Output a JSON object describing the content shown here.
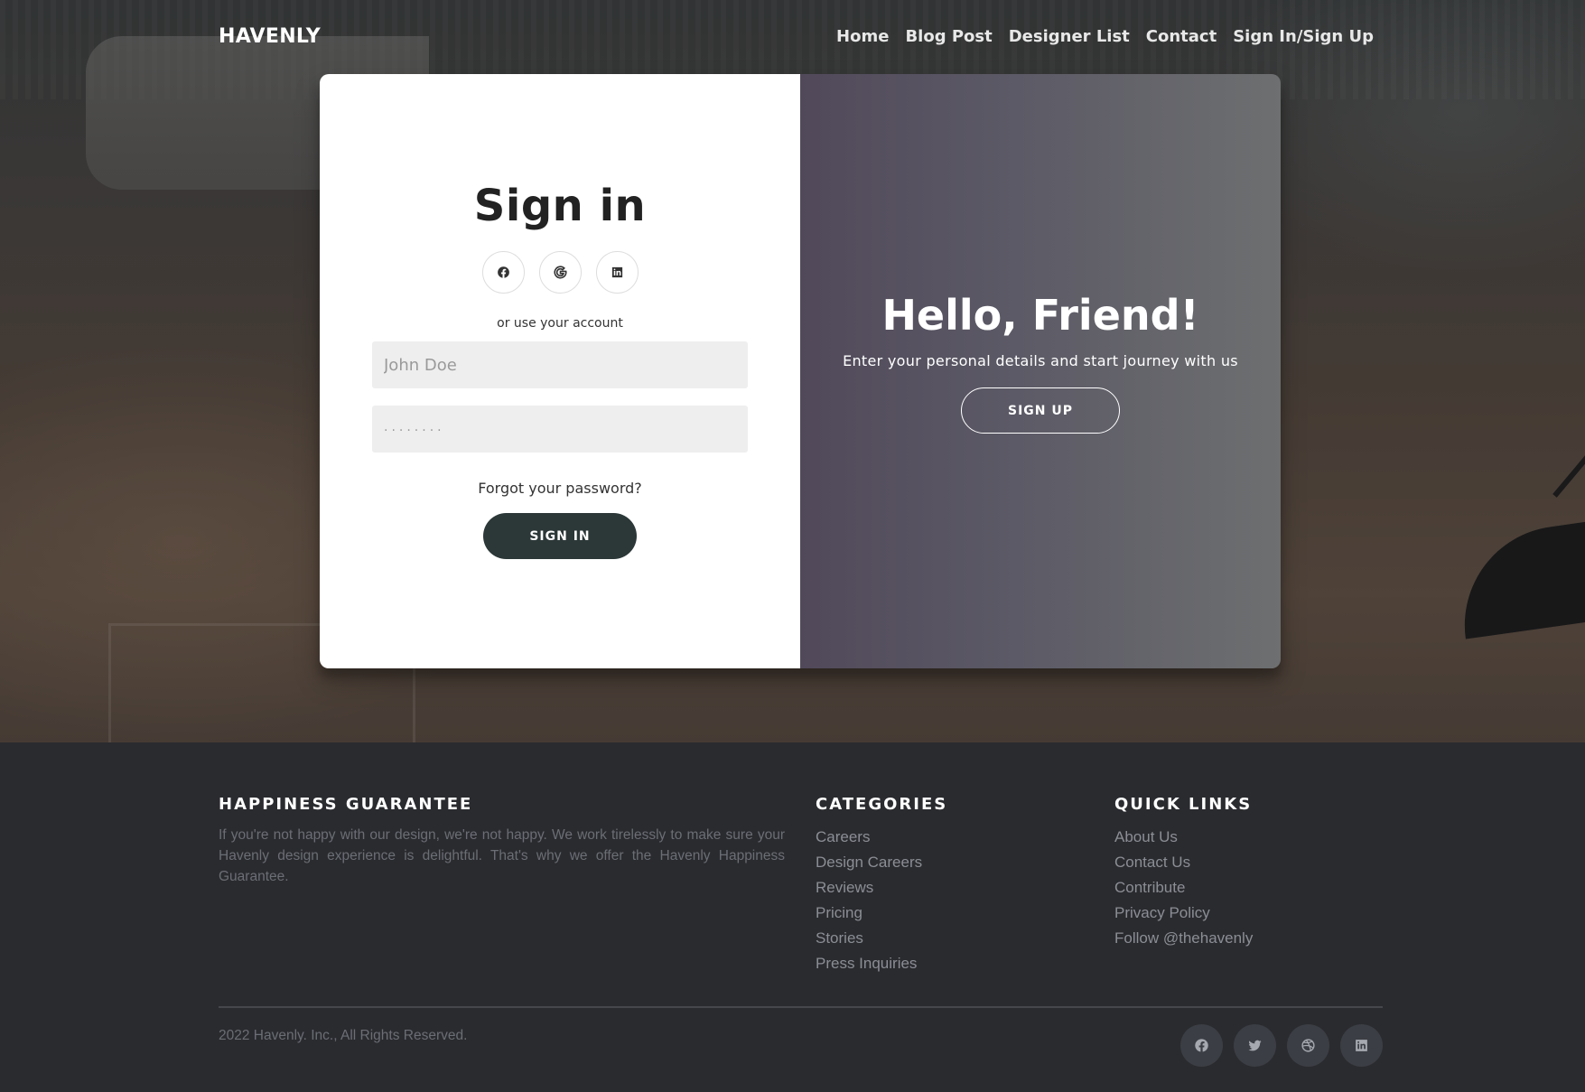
{
  "brand": "HAVENLY",
  "nav": {
    "items": [
      "Home",
      "Blog Post",
      "Designer List",
      "Contact",
      "Sign In/Sign Up"
    ]
  },
  "signin": {
    "title": "Sign in",
    "social_icons": [
      "facebook-icon",
      "google-icon",
      "linkedin-icon"
    ],
    "alt_text": "or use your account",
    "username_placeholder": "John Doe",
    "password_placeholder": "········",
    "forgot": "Forgot your password?",
    "button": "SIGN IN"
  },
  "overlay": {
    "title": "Hello, Friend!",
    "text": "Enter your personal details and start journey with us",
    "button": "SIGN UP"
  },
  "footer": {
    "about": {
      "heading": "HAPPINESS GUARANTEE",
      "text": "If you're not happy with our design, we're not happy. We work tirelessly to make sure your Havenly design experience is delightful. That's why we offer the Havenly Happiness Guarantee."
    },
    "categories": {
      "heading": "CATEGORIES",
      "items": [
        "Careers",
        "Design Careers",
        "Reviews",
        "Pricing",
        "Stories",
        "Press Inquiries"
      ]
    },
    "quick_links": {
      "heading": "QUICK LINKS",
      "items": [
        "About Us",
        "Contact Us",
        "Contribute",
        "Privacy Policy",
        "Follow @thehavenly"
      ]
    },
    "copyright": "2022 Havenly. Inc., All Rights Reserved.",
    "social_icons": [
      "facebook-icon",
      "twitter-icon",
      "dribbble-icon",
      "linkedin-icon"
    ]
  },
  "colors": {
    "card_button": "#2c3737",
    "overlay_gradient_start": "#51495a",
    "overlay_gradient_end": "#6d6f70",
    "footer_bg": "#2a2b2f"
  }
}
